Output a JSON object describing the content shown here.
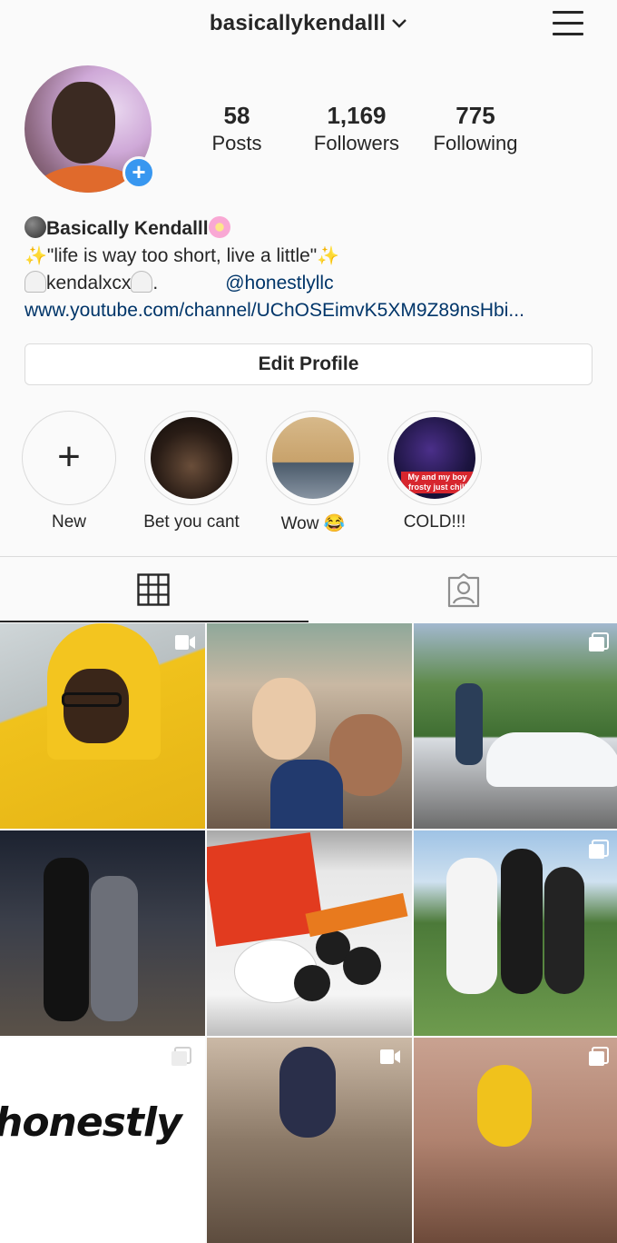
{
  "header": {
    "username": "basicallykendalll",
    "username_dropdown_icon": "chevron-down-icon",
    "menu_icon": "hamburger-menu-icon"
  },
  "profile": {
    "stats": [
      {
        "value": "58",
        "label": "Posts"
      },
      {
        "value": "1,169",
        "label": "Followers"
      },
      {
        "value": "775",
        "label": "Following"
      }
    ],
    "name": "Basically Kendalll",
    "bio_line1": "\"life is way too short, live a little\"",
    "bio_line2_handle": "kendalxcx",
    "bio_line2_dot": ".",
    "bio_line2_mention": "@honestlyllc",
    "website": "www.youtube.com/channel/UChOSEimvK5XM9Z89nsHbi...",
    "edit_button": "Edit Profile"
  },
  "highlights": [
    {
      "label": "New"
    },
    {
      "label": "Bet you cant"
    },
    {
      "label": "Wow 😂"
    },
    {
      "label": "COLD!!!",
      "caption": "My and my boy frosty just chill"
    }
  ],
  "tabs": [
    {
      "icon": "grid-icon",
      "active": true
    },
    {
      "icon": "tagged-person-icon",
      "active": false
    }
  ],
  "posts": [
    {
      "badge": "video-icon"
    },
    {
      "badge": ""
    },
    {
      "badge": "carousel-icon"
    },
    {
      "badge": ""
    },
    {
      "badge": ""
    },
    {
      "badge": "carousel-icon"
    },
    {
      "badge": "carousel-icon",
      "overlay_text": "honestly"
    },
    {
      "badge": "video-icon"
    },
    {
      "badge": "carousel-icon"
    }
  ],
  "colors": {
    "link": "#003569",
    "accent_blue": "#3897f0",
    "border": "#dbdbdb",
    "text": "#262626",
    "background": "#fafafa"
  }
}
